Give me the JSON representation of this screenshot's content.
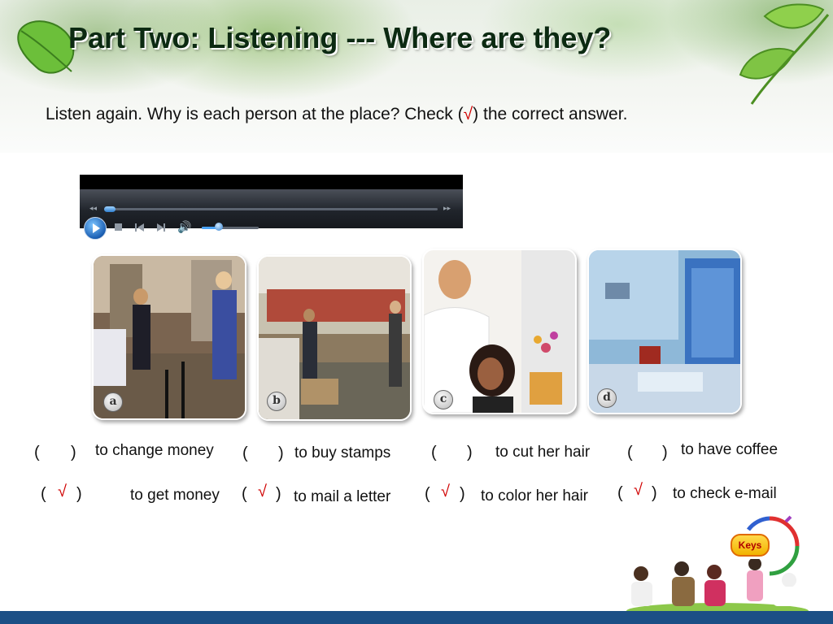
{
  "slide": {
    "title": "Part Two: Listening --- Where are they?",
    "instruction_before": "Listen again. Why is each person at the place? Check (",
    "instruction_mark": "√",
    "instruction_after": ") the correct answer."
  },
  "player": {
    "rewind_label": "◂◂",
    "forward_label": "▸▸",
    "seek_progress": 0.0,
    "volume_level": 0.3
  },
  "photos": [
    {
      "letter": "a"
    },
    {
      "letter": "b"
    },
    {
      "letter": "c"
    },
    {
      "letter": "d"
    }
  ],
  "answers": {
    "open_paren": "(",
    "close_paren": ")",
    "check_mark": "√",
    "row1": [
      {
        "text": "to change money",
        "checked": false
      },
      {
        "text": "to buy stamps",
        "checked": false
      },
      {
        "text": "to cut her hair",
        "checked": false
      },
      {
        "text": "to have coffee",
        "checked": false
      }
    ],
    "row2": [
      {
        "text": "to get money",
        "checked": true
      },
      {
        "text": "to mail a letter",
        "checked": true
      },
      {
        "text": "to color her hair",
        "checked": true
      },
      {
        "text": "to check e-mail",
        "checked": true
      }
    ]
  },
  "keys_button": "Keys",
  "colors": {
    "check_red": "#d00000",
    "footer_blue": "#1c4f86",
    "title_green": "#0c2a12"
  }
}
